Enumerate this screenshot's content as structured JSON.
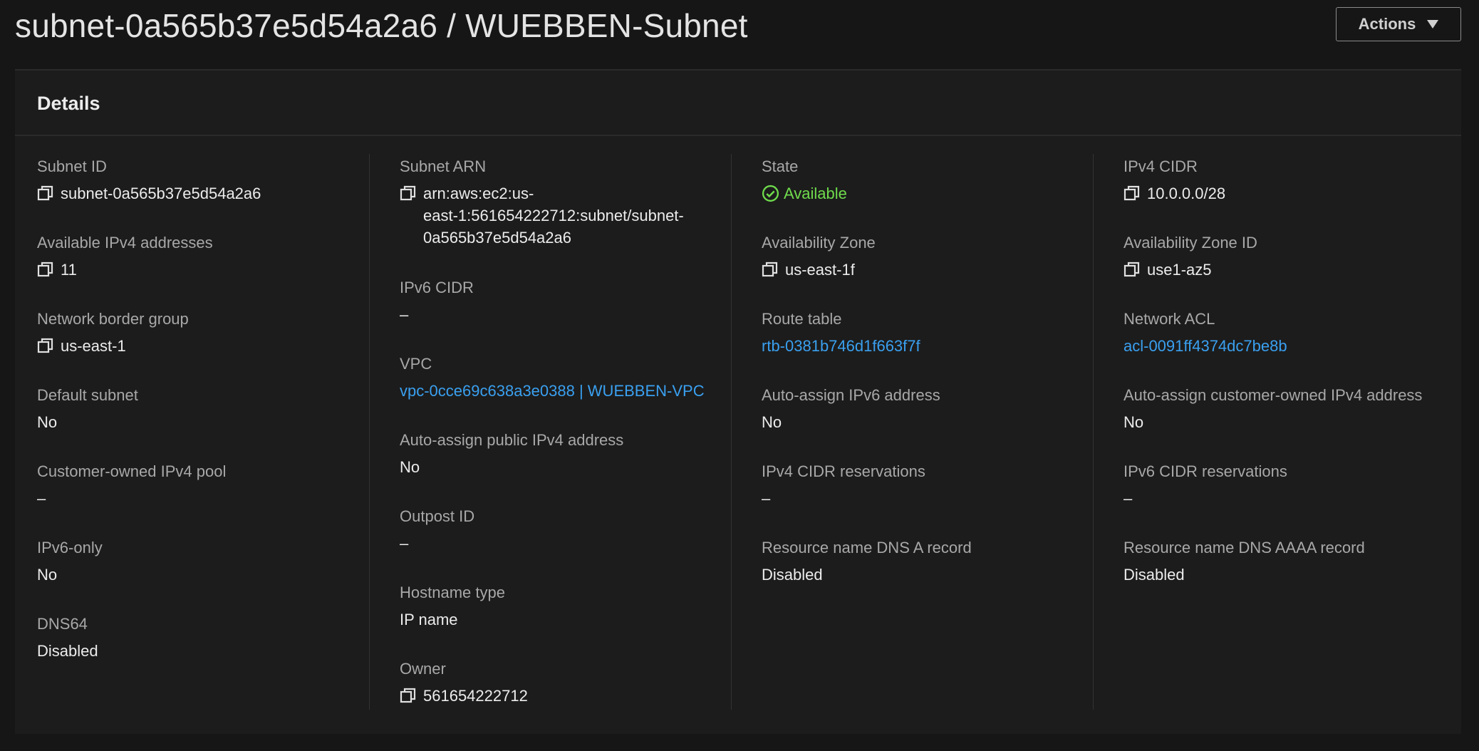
{
  "header": {
    "title": "subnet-0a565b37e5d54a2a6 / WUEBBEN-Subnet",
    "actions_label": "Actions"
  },
  "details": {
    "title": "Details",
    "columns": [
      [
        {
          "label": "Subnet ID",
          "value": "subnet-0a565b37e5d54a2a6",
          "copy": true
        },
        {
          "label": "Available IPv4 addresses",
          "value": "11",
          "copy": true
        },
        {
          "label": "Network border group",
          "value": "us-east-1",
          "copy": true
        },
        {
          "label": "Default subnet",
          "value": "No"
        },
        {
          "label": "Customer-owned IPv4 pool",
          "value": "–"
        },
        {
          "label": "IPv6-only",
          "value": "No"
        },
        {
          "label": "DNS64",
          "value": "Disabled"
        }
      ],
      [
        {
          "label": "Subnet ARN",
          "value": "arn:aws:ec2:us-east-1:561654222712:subnet/subnet-0a565b37e5d54a2a6",
          "value_lines": [
            "arn:aws:ec2:us-",
            "east-1:561654222712:subnet/subnet-",
            "0a565b37e5d54a2a6"
          ],
          "copy": true
        },
        {
          "label": "IPv6 CIDR",
          "value": "–"
        },
        {
          "label": "VPC",
          "value": "vpc-0cce69c638a3e0388 | WUEBBEN-VPC",
          "link": true
        },
        {
          "label": "Auto-assign public IPv4 address",
          "value": "No"
        },
        {
          "label": "Outpost ID",
          "value": "–"
        },
        {
          "label": "Hostname type",
          "value": "IP name"
        },
        {
          "label": "Owner",
          "value": "561654222712",
          "copy": true
        }
      ],
      [
        {
          "label": "State",
          "value": "Available",
          "status": "success"
        },
        {
          "label": "Availability Zone",
          "value": "us-east-1f",
          "copy": true
        },
        {
          "label": "Route table",
          "value": "rtb-0381b746d1f663f7f",
          "link": true
        },
        {
          "label": "Auto-assign IPv6 address",
          "value": "No"
        },
        {
          "label": "IPv4 CIDR reservations",
          "value": "–"
        },
        {
          "label": "Resource name DNS A record",
          "value": "Disabled"
        }
      ],
      [
        {
          "label": "IPv4 CIDR",
          "value": "10.0.0.0/28",
          "copy": true
        },
        {
          "label": "Availability Zone ID",
          "value": "use1-az5",
          "copy": true
        },
        {
          "label": "Network ACL",
          "value": "acl-0091ff4374dc7be8b",
          "link": true
        },
        {
          "label": "Auto-assign customer-owned IPv4 address",
          "value": "No"
        },
        {
          "label": "IPv6 CIDR reservations",
          "value": "–"
        },
        {
          "label": "Resource name DNS AAAA record",
          "value": "Disabled"
        }
      ]
    ]
  },
  "colors": {
    "background": "#161616",
    "panel": "#1c1c1c",
    "link": "#3aa0f0",
    "success": "#6fdc4c",
    "label": "#a8a8a8",
    "value": "#ececec"
  },
  "icons": {
    "copy": "copy-icon",
    "status": "status-check-icon",
    "actions_caret": "caret-down-icon"
  }
}
